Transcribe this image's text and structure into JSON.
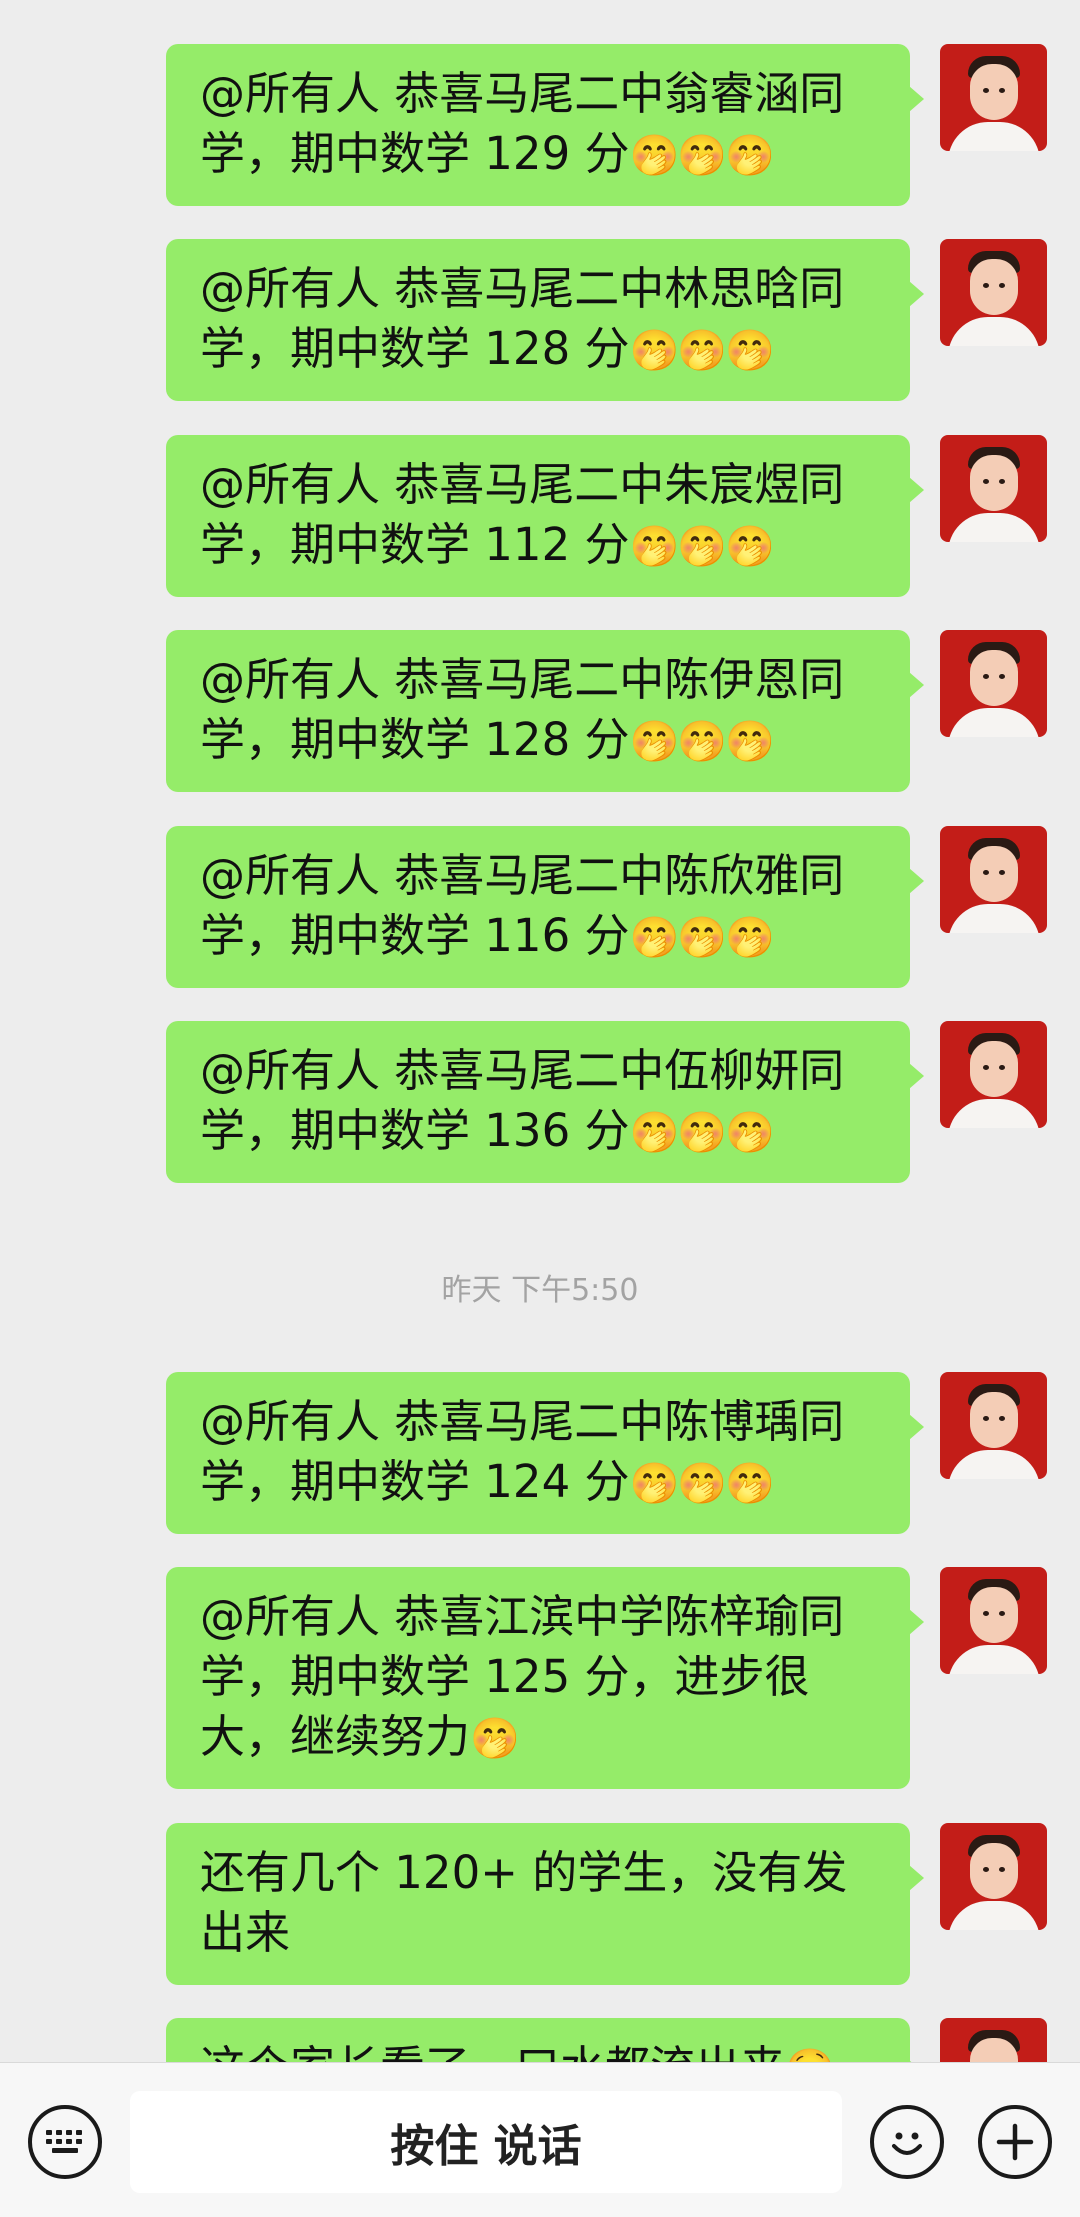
{
  "messages": [
    {
      "text": "@所有人  恭喜马尾二中翁睿涵同学，期中数学 129 分",
      "emoji": "🤭🤭🤭"
    },
    {
      "text": "@所有人  恭喜马尾二中林思晗同学，期中数学 128 分",
      "emoji": "🤭🤭🤭"
    },
    {
      "text": "@所有人  恭喜马尾二中朱宸煜同学，期中数学 112 分",
      "emoji": "🤭🤭🤭"
    },
    {
      "text": "@所有人  恭喜马尾二中陈伊恩同学，期中数学 128 分",
      "emoji": "🤭🤭🤭"
    },
    {
      "text": "@所有人  恭喜马尾二中陈欣雅同学，期中数学 116 分",
      "emoji": "🤭🤭🤭"
    },
    {
      "text": "@所有人  恭喜马尾二中伍柳妍同学，期中数学 136 分",
      "emoji": "🤭🤭🤭"
    },
    {
      "text": "@所有人  恭喜马尾二中陈博瑀同学，期中数学 124 分",
      "emoji": "🤭🤭🤭"
    },
    {
      "text": "@所有人  恭喜江滨中学陈梓瑜同学，期中数学 125 分，进步很大，继续努力",
      "emoji": "🤭"
    },
    {
      "text": "还有几个 120+ 的学生，没有发出来",
      "emoji": ""
    },
    {
      "text": "这个家长看了，口水都流出来",
      "emoji": "🤤"
    }
  ],
  "timestamp": "昨天 下午5:50",
  "input_bar": {
    "voice_label": "按住 说话",
    "keyboard_icon": "keyboard-icon",
    "emoji_icon": "smiley-icon",
    "more_icon": "plus-icon"
  },
  "colors": {
    "bubble": "#95ec69",
    "background": "#ededed",
    "avatar_bg": "#c31d18"
  }
}
